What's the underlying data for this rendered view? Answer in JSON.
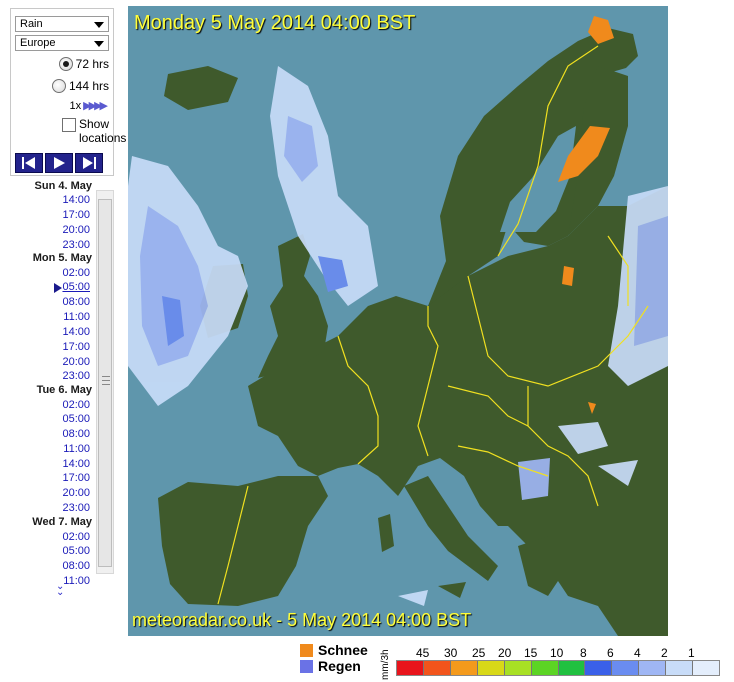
{
  "controls": {
    "layer_select": "Rain",
    "region_select": "Europe",
    "range_options": [
      {
        "label": "72 hrs",
        "selected": true
      },
      {
        "label": "144 hrs",
        "selected": false
      }
    ],
    "speed_label": "1x",
    "show_locations_line1": "Show",
    "show_locations_line2": "locations",
    "show_locations_checked": false,
    "player": [
      "first-icon",
      "play-icon",
      "last-icon"
    ]
  },
  "timeline": {
    "days": [
      {
        "label": "Sun 4. May",
        "times": [
          "14:00",
          "17:00",
          "20:00",
          "23:00"
        ]
      },
      {
        "label": "Mon 5. May",
        "times": [
          "02:00",
          "05:00",
          "08:00",
          "11:00",
          "14:00",
          "17:00",
          "20:00",
          "23:00"
        ]
      },
      {
        "label": "Tue 6. May",
        "times": [
          "02:00",
          "05:00",
          "08:00",
          "11:00",
          "14:00",
          "17:00",
          "20:00",
          "23:00"
        ]
      },
      {
        "label": "Wed 7. May",
        "times": [
          "02:00",
          "05:00",
          "08:00",
          "11:00"
        ]
      }
    ],
    "current": "05:00",
    "more_icon": "double-chevron-down-icon"
  },
  "map": {
    "title": "Monday 5 May 2014 04:00 BST",
    "footer": "meteoradar.co.uk - 5 May 2014 04:00 BST",
    "sea_color": "#5f96ac",
    "land_color": "#3f5a2c",
    "border_color": "#f0e020"
  },
  "legend": {
    "snow_label": "Schnee",
    "snow_color": "#f08a1c",
    "rain_label": "Regen",
    "rain_color": "#6a72e6",
    "unit": "mm/3h",
    "scale": [
      "45",
      "30",
      "25",
      "20",
      "15",
      "10",
      "8",
      "6",
      "4",
      "2",
      "1"
    ],
    "colors": [
      "#e8141c",
      "#f2541c",
      "#f49a1c",
      "#d8d818",
      "#a8e024",
      "#5cd424",
      "#20c040",
      "#3a60e8",
      "#6a8cf0",
      "#9fb6f4",
      "#c8dcf8",
      "#e4eefc"
    ]
  }
}
